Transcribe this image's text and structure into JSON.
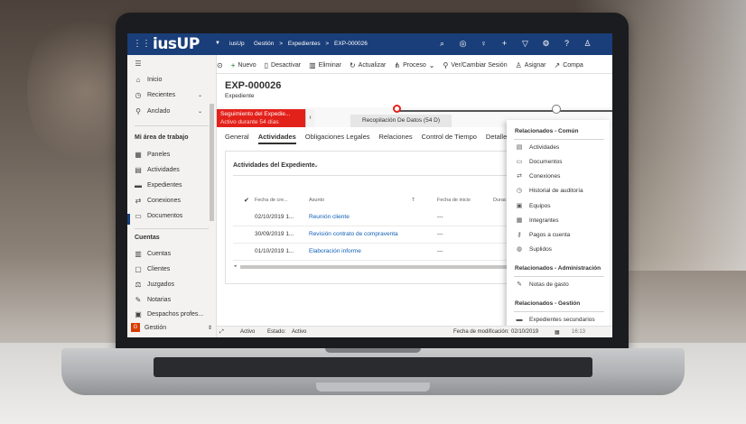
{
  "topbar": {
    "logo": "iusUP",
    "app_name": "iusUp",
    "breadcrumbs": [
      "Gestión",
      ">",
      "Expedientes",
      ">",
      "EXP-000026"
    ],
    "icons": [
      "search-icon",
      "lightbulb-target-icon",
      "lightbulb-icon",
      "plus-icon",
      "filter-icon",
      "gear-icon",
      "help-icon",
      "user-icon"
    ]
  },
  "commands": [
    {
      "label": "",
      "icon": "history"
    },
    {
      "label": "Nuevo",
      "icon": "plus"
    },
    {
      "label": "Desactivar",
      "icon": "doc-x"
    },
    {
      "label": "Eliminar",
      "icon": "trash"
    },
    {
      "label": "Actualizar",
      "icon": "refresh"
    },
    {
      "label": "Proceso",
      "icon": "process"
    },
    {
      "label": "Ver/Cambiar Sesión",
      "icon": "session"
    },
    {
      "label": "Asignar",
      "icon": "assign"
    },
    {
      "label": "Compa",
      "icon": "share"
    }
  ],
  "sidebar": {
    "top_items": [
      {
        "label": "Inicio",
        "icon": "home"
      },
      {
        "label": "Recientes",
        "icon": "clock"
      },
      {
        "label": "Anclado",
        "icon": "pin"
      }
    ],
    "section1": "Mi área de trabajo",
    "work_items": [
      {
        "label": "Paneles",
        "icon": "dashboard"
      },
      {
        "label": "Actividades",
        "icon": "activities"
      },
      {
        "label": "Expedientes",
        "icon": "folder"
      },
      {
        "label": "Conexiones",
        "icon": "connections"
      },
      {
        "label": "Documentos",
        "icon": "document"
      }
    ],
    "section2": "Cuentas",
    "account_items": [
      {
        "label": "Cuentas",
        "icon": "accounts"
      },
      {
        "label": "Clientes",
        "icon": "clients"
      },
      {
        "label": "Juzgados",
        "icon": "court"
      },
      {
        "label": "Notarias",
        "icon": "notary"
      },
      {
        "label": "Despachos profes...",
        "icon": "office"
      }
    ],
    "area": {
      "badge": "G",
      "label": "Gestión"
    }
  },
  "record": {
    "title": "EXP-000026",
    "entity": "Expediente"
  },
  "bpf": {
    "active_stage_line1": "Seguimiento del Expedie...",
    "active_stage_line2": "Activo durante 54 días",
    "stage_label": "Recopilación De Datos  (54 D)"
  },
  "tabs": [
    "General",
    "Actividades",
    "Obligaciones Legales",
    "Relaciones",
    "Control de Tiempo",
    "Detalles"
  ],
  "subgrid": {
    "title": "Actividades del Expediente",
    "columns": [
      "Fecha de cre...",
      "Asunto",
      "T",
      "Fecha de inicio",
      "Durac"
    ],
    "rows": [
      {
        "date": "02/10/2019 1...",
        "subject": "Reunión cliente",
        "start": "---"
      },
      {
        "date": "30/09/2019 1...",
        "subject": "Revisión contrato de compraventa",
        "start": "---"
      },
      {
        "date": "01/10/2019 1...",
        "subject": "Elaboración informe",
        "start": "---"
      }
    ]
  },
  "flyout": {
    "section_common": "Relacionados - Común",
    "common_items": [
      {
        "label": "Actividades",
        "icon": "activities"
      },
      {
        "label": "Documentos",
        "icon": "document"
      },
      {
        "label": "Conexiones",
        "icon": "connections"
      },
      {
        "label": "Historial de auditoría",
        "icon": "history"
      },
      {
        "label": "Equipos",
        "icon": "team"
      },
      {
        "label": "Integrantes",
        "icon": "members"
      },
      {
        "label": "Pagos a cuenta",
        "icon": "key"
      },
      {
        "label": "Suplidos",
        "icon": "globe"
      }
    ],
    "section_admin": "Relacionados - Administración",
    "admin_items": [
      {
        "label": "Notas de gasto",
        "icon": "edit"
      }
    ],
    "section_gestion": "Relacionados - Gestión",
    "gestion_items": [
      {
        "label": "Expedientes secundarios",
        "icon": "folder"
      }
    ]
  },
  "statusbar": {
    "status": "Activo",
    "estado_label": "Estado:",
    "estado_value": "Activo",
    "modified_label": "Fecha de modificación:",
    "modified_date": "02/10/2019",
    "modified_time": "16:13"
  }
}
